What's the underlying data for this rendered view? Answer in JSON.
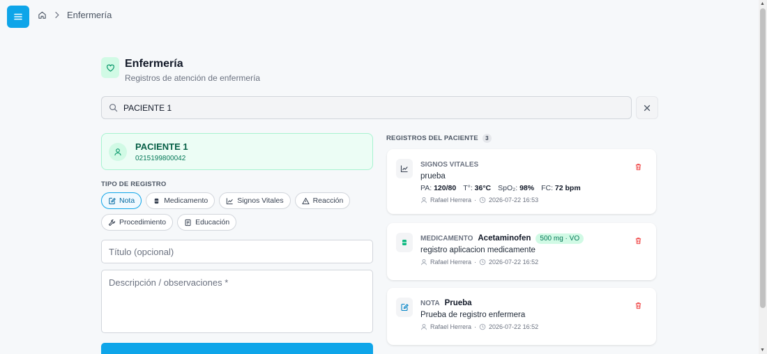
{
  "breadcrumb": {
    "home_icon": "home-icon",
    "current": "Enfermería"
  },
  "header": {
    "title": "Enfermería",
    "subtitle": "Registros de atención de enfermería",
    "icon": "heart-icon"
  },
  "search": {
    "value": "PACIENTE 1",
    "placeholder": ""
  },
  "patient": {
    "name": "PACIENTE 1",
    "id": "0215199800042"
  },
  "record_type": {
    "label": "TIPO DE REGISTRO",
    "options": [
      {
        "label": "Nota",
        "icon": "note-pen-icon",
        "active": true
      },
      {
        "label": "Medicamento",
        "icon": "pill-icon",
        "active": false
      },
      {
        "label": "Signos Vitales",
        "icon": "chart-line-icon",
        "active": false
      },
      {
        "label": "Reacción",
        "icon": "warning-icon",
        "active": false
      },
      {
        "label": "Procedimiento",
        "icon": "wrench-icon",
        "active": false
      },
      {
        "label": "Educación",
        "icon": "book-icon",
        "active": false
      }
    ]
  },
  "form": {
    "title_placeholder": "Título (opcional)",
    "desc_placeholder": "Descripción / observaciones *"
  },
  "records": {
    "label": "REGISTROS DEL PACIENTE",
    "count": "3",
    "items": [
      {
        "type": "SIGNOS VITALES",
        "text": "prueba",
        "vitals": [
          {
            "label": "PA:",
            "value": "120/80"
          },
          {
            "label": "T°:",
            "value": "36°C"
          },
          {
            "label": "SpO₂:",
            "value": "98%"
          },
          {
            "label": "FC:",
            "value": "72 bpm"
          }
        ],
        "author": "Rafael Herrera",
        "date": "2026-07-22 16:53"
      },
      {
        "type": "MEDICAMENTO",
        "name": "Acetaminofen",
        "dose": "500 mg · VO",
        "text": "registro aplicacion medicamente",
        "author": "Rafael Herrera",
        "date": "2026-07-22 16:52"
      },
      {
        "type": "NOTA",
        "name": "Prueba",
        "text": "Prueba de registro enfermera",
        "author": "Rafael Herrera",
        "date": "2026-07-22 16:52"
      }
    ]
  },
  "colors": {
    "accent": "#0ea5e9",
    "success": "#10b981",
    "danger": "#ef4444"
  }
}
